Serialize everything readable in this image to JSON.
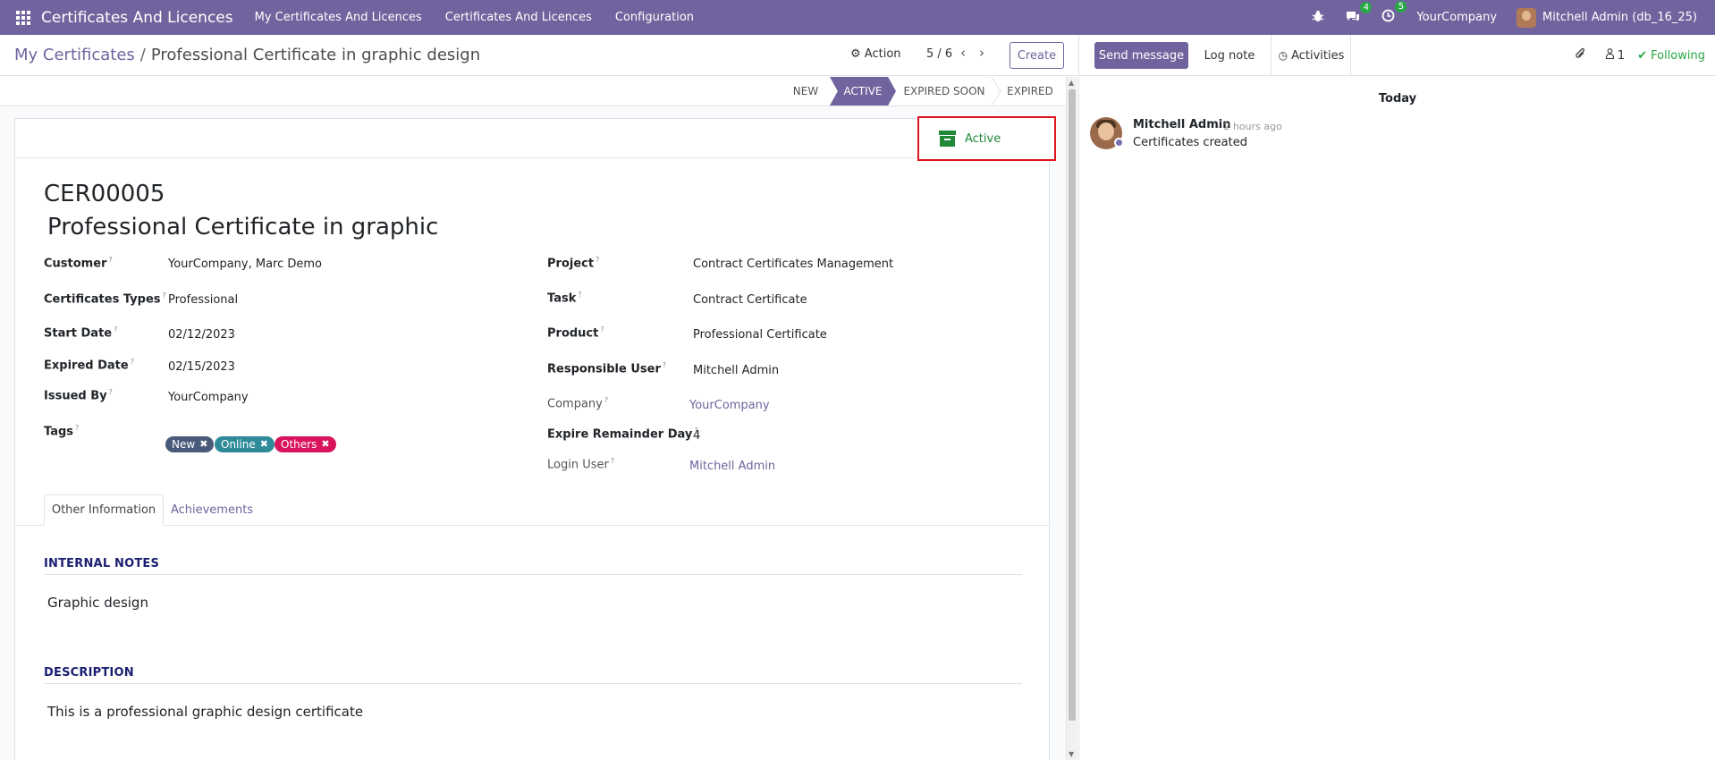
{
  "navbar": {
    "app_title": "Certificates And Licences",
    "menus": [
      "My Certificates And Licences",
      "Certificates And Licences",
      "Configuration"
    ],
    "messages_count": "4",
    "activities_count": "5",
    "company": "YourCompany",
    "user": "Mitchell Admin (db_16_25)"
  },
  "control": {
    "breadcrumb_parent": "My Certificates",
    "breadcrumb_sep": "/",
    "breadcrumb_current": "Professional Certificate in graphic design",
    "action_label": "Action",
    "pager_value": "5 / 6",
    "create_label": "Create"
  },
  "statusbar": {
    "stages": [
      "NEW",
      "ACTIVE",
      "EXPIRED SOON",
      "EXPIRED"
    ],
    "current": "ACTIVE"
  },
  "smart_button": {
    "label": "Active"
  },
  "record": {
    "reference": "CER00005",
    "name": "Professional Certificate in graphic"
  },
  "fields_left": [
    {
      "label": "Customer",
      "value": "YourCompany, Marc Demo"
    },
    {
      "label": "Certificates Types",
      "value": "Professional"
    },
    {
      "label": "Start Date",
      "value": "02/12/2023"
    },
    {
      "label": "Expired Date",
      "value": "02/15/2023"
    },
    {
      "label": "Issued By",
      "value": "YourCompany"
    },
    {
      "label": "Tags",
      "value": ""
    }
  ],
  "tags": [
    {
      "label": "New",
      "color": "#4a5a7a"
    },
    {
      "label": "Online",
      "color": "#2e8b9a"
    },
    {
      "label": "Others",
      "color": "#d9135c"
    }
  ],
  "fields_right": [
    {
      "label": "Project",
      "value": "Contract Certificates Management"
    },
    {
      "label": "Task",
      "value": "Contract Certificate"
    },
    {
      "label": "Product",
      "value": "Professional Certificate"
    },
    {
      "label": "Responsible User",
      "value": "Mitchell Admin"
    },
    {
      "label": "Company",
      "value": "YourCompany"
    },
    {
      "label": "Expire Remainder Day",
      "value": "4"
    },
    {
      "label": "Login User",
      "value": "Mitchell Admin"
    }
  ],
  "tabs": [
    "Other Information",
    "Achievements"
  ],
  "internal_notes": {
    "title": "INTERNAL NOTES",
    "text": "Graphic design"
  },
  "description": {
    "title": "DESCRIPTION",
    "text": "This is a professional graphic design certificate"
  },
  "chatter": {
    "send_message": "Send message",
    "log_note": "Log note",
    "activities": "Activities",
    "followers_count": "1",
    "following": "Following",
    "today": "Today",
    "message": {
      "author": "Mitchell Admin",
      "date": "- 2 hours ago",
      "body": "Certificates created"
    }
  },
  "colors": {
    "brand": "#71639e",
    "success": "#28a745",
    "highlight_border": "#e0141e"
  }
}
